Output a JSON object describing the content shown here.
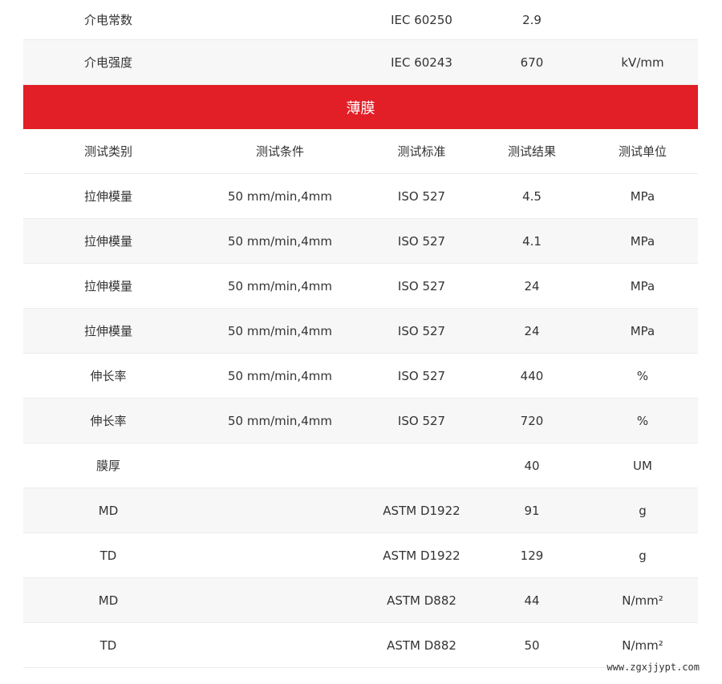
{
  "top_rows": [
    {
      "category": "介电常数",
      "condition": "",
      "standard": "IEC 60250",
      "result": "2.9",
      "unit": ""
    },
    {
      "category": "介电强度",
      "condition": "",
      "standard": "IEC 60243",
      "result": "670",
      "unit": "kV/mm"
    }
  ],
  "section": {
    "title": "薄膜"
  },
  "header": {
    "category": "测试类别",
    "condition": "测试条件",
    "standard": "测试标准",
    "result": "测试结果",
    "unit": "测试单位"
  },
  "rows": [
    {
      "category": "拉伸模量",
      "condition": "50 mm/min,4mm",
      "standard": "ISO 527",
      "result": "4.5",
      "unit": "MPa"
    },
    {
      "category": "拉伸模量",
      "condition": "50 mm/min,4mm",
      "standard": "ISO 527",
      "result": "4.1",
      "unit": "MPa"
    },
    {
      "category": "拉伸模量",
      "condition": "50 mm/min,4mm",
      "standard": "ISO 527",
      "result": "24",
      "unit": "MPa"
    },
    {
      "category": "拉伸模量",
      "condition": "50 mm/min,4mm",
      "standard": "ISO 527",
      "result": "24",
      "unit": "MPa"
    },
    {
      "category": "伸长率",
      "condition": "50 mm/min,4mm",
      "standard": "ISO 527",
      "result": "440",
      "unit": "%"
    },
    {
      "category": "伸长率",
      "condition": "50 mm/min,4mm",
      "standard": "ISO 527",
      "result": "720",
      "unit": "%"
    },
    {
      "category": "膜厚",
      "condition": "",
      "standard": "",
      "result": "40",
      "unit": "UM"
    },
    {
      "category": "MD",
      "condition": "",
      "standard": "ASTM D1922",
      "result": "91",
      "unit": "g"
    },
    {
      "category": "TD",
      "condition": "",
      "standard": "ASTM D1922",
      "result": "129",
      "unit": "g"
    },
    {
      "category": "MD",
      "condition": "",
      "standard": "ASTM D882",
      "result": "44",
      "unit": "N/mm²"
    },
    {
      "category": "TD",
      "condition": "",
      "standard": "ASTM D882",
      "result": "50",
      "unit": "N/mm²"
    }
  ],
  "watermark": "www.zgxjjypt.com",
  "colors": {
    "band": "#e21e26",
    "shade": "#f7f7f7",
    "text": "#333333"
  }
}
